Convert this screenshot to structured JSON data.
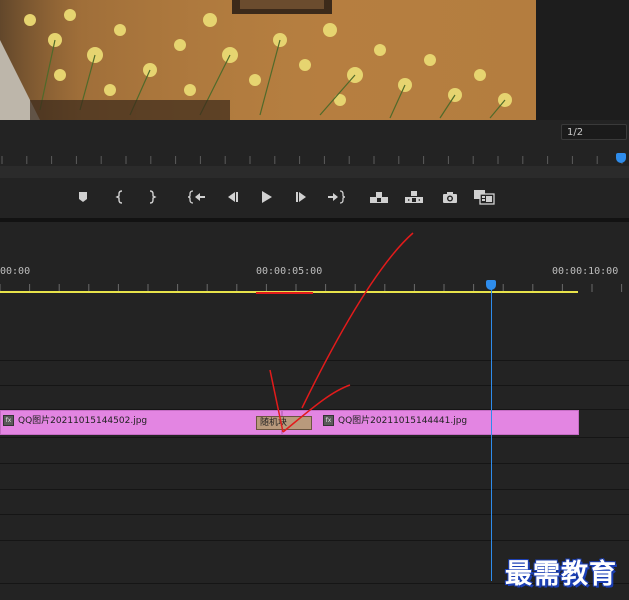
{
  "monitor": {
    "zoom_value": "1/2"
  },
  "timeline": {
    "timecodes": [
      "00:00",
      "00:00:05:00",
      "00:00:10:00"
    ],
    "clips": [
      {
        "name": "QQ图片20211015144502.jpg"
      },
      {
        "name": "QQ图片20211015144441.jpg"
      }
    ],
    "transition_label": "随机块",
    "colors": {
      "clip": "#e385e2",
      "work_area": "#e8e34a",
      "playhead": "#2e8ceb",
      "annotation": "#e21b1b"
    }
  },
  "transport": {
    "icons": [
      "add-marker-icon",
      "mark-in-icon",
      "mark-out-icon",
      "go-to-in-icon",
      "step-back-icon",
      "play-icon",
      "step-forward-icon",
      "go-to-out-icon",
      "lift-icon",
      "extract-icon",
      "export-frame-icon",
      "compare-view-icon"
    ]
  },
  "watermark": {
    "text": "最需教育"
  }
}
